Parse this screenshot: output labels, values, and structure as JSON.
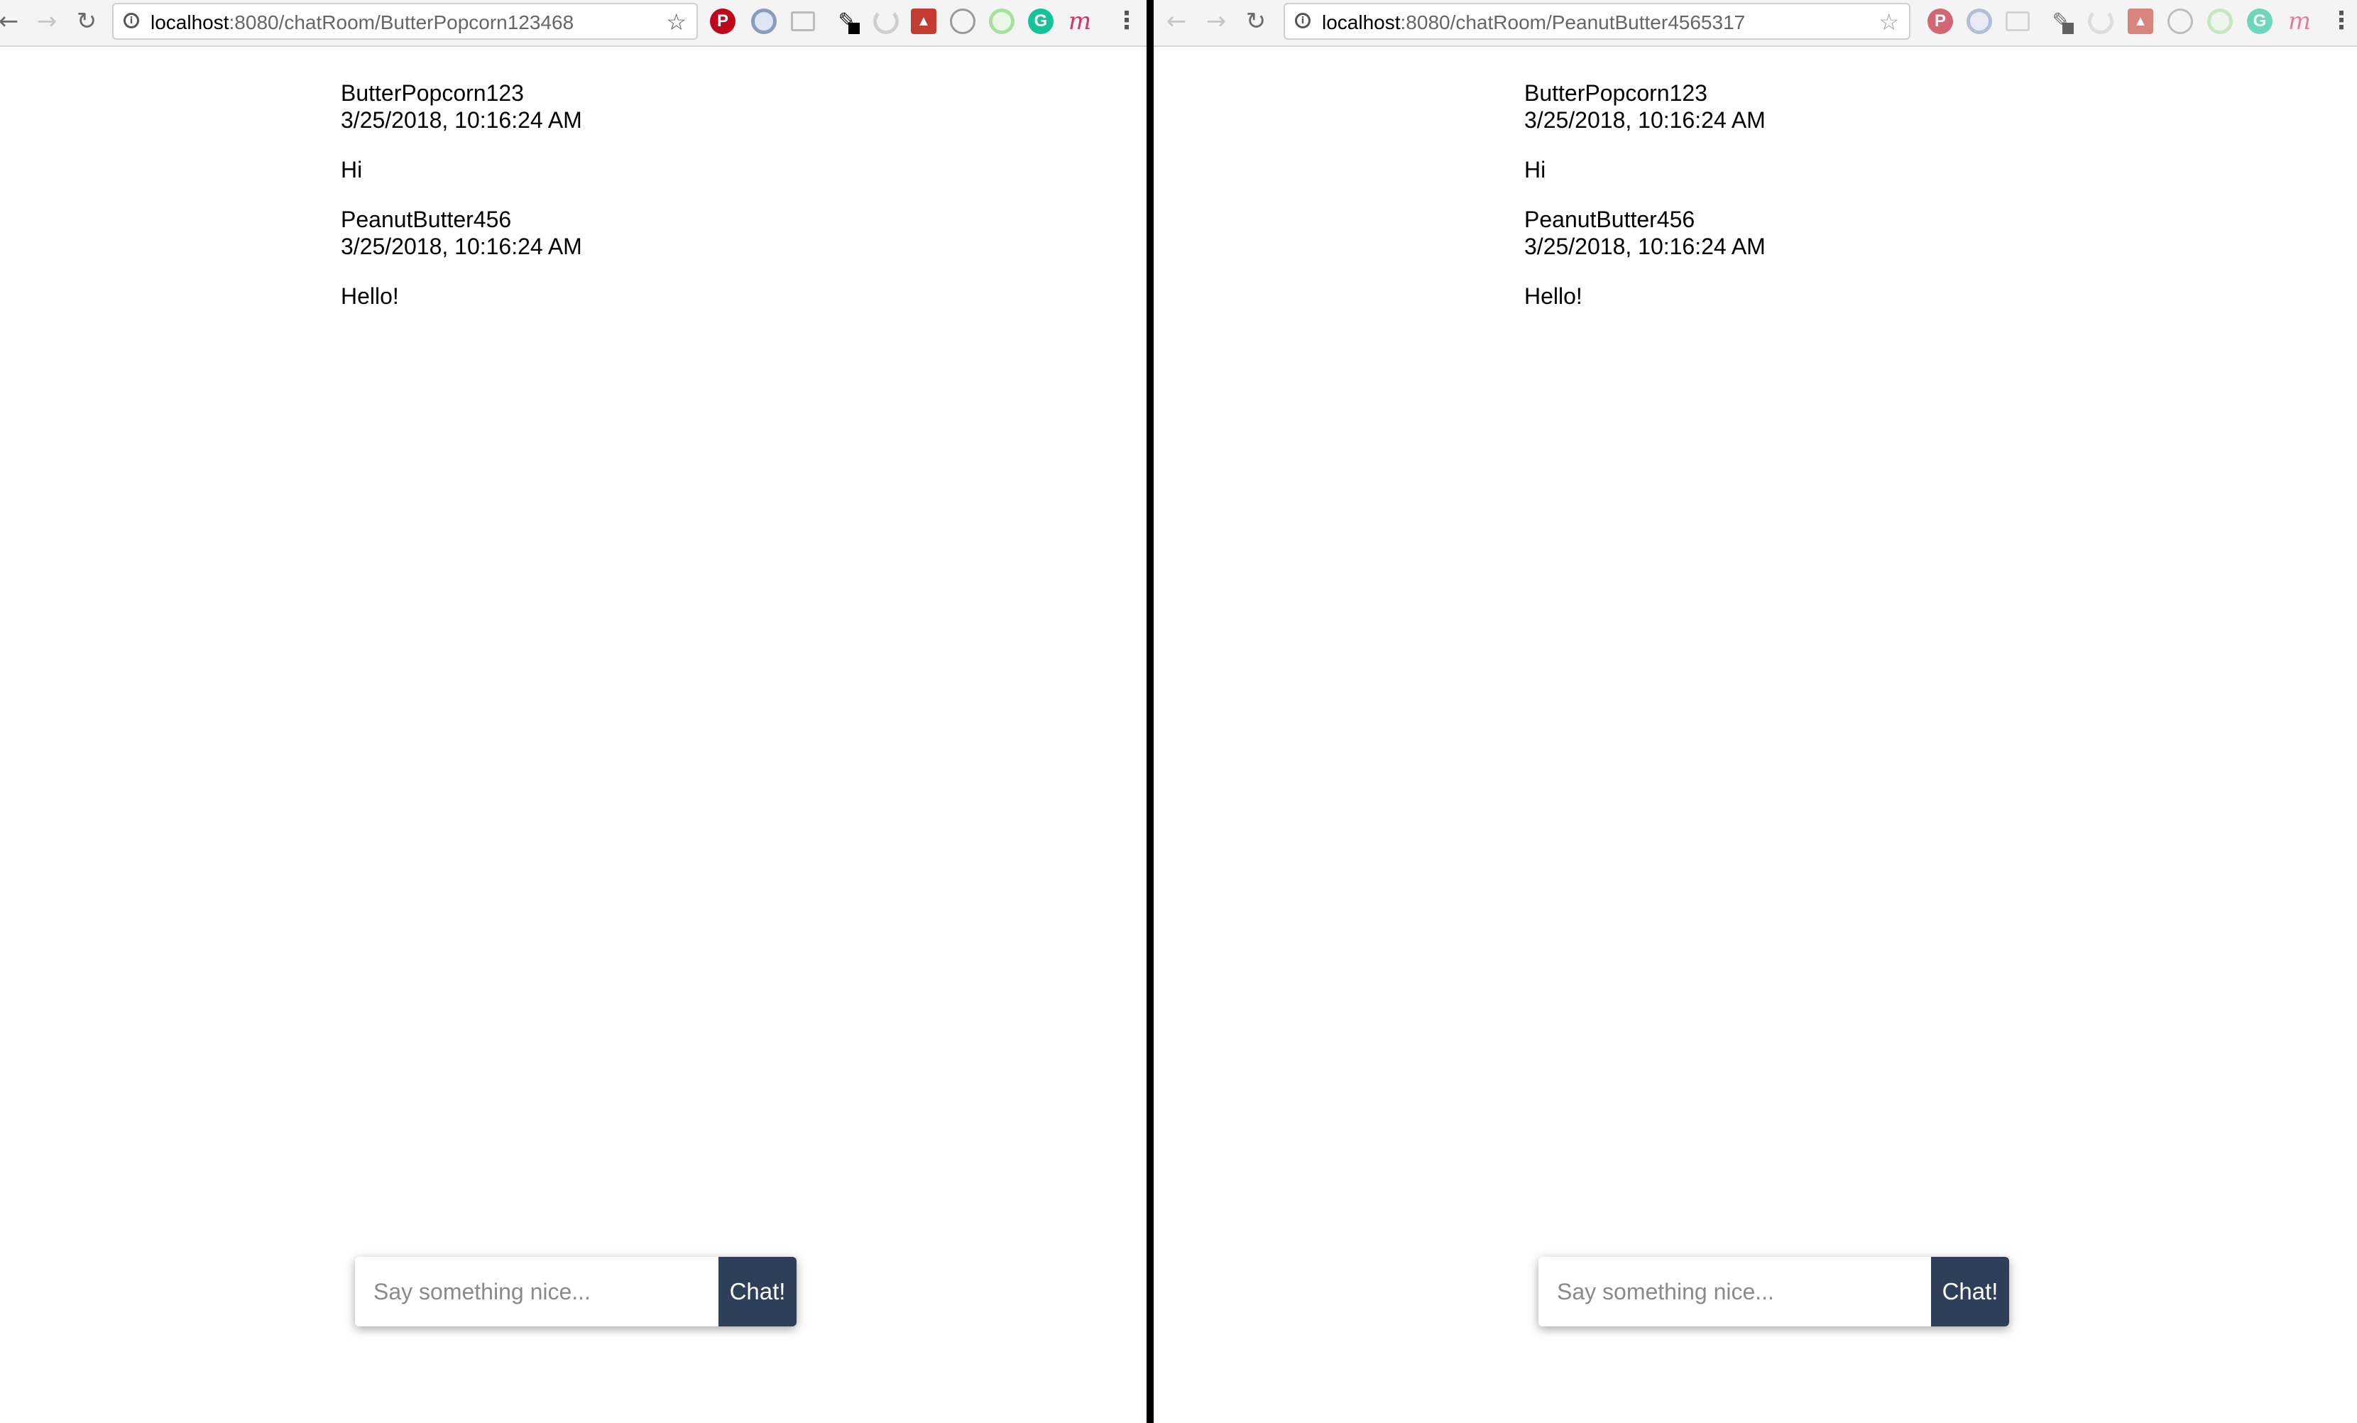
{
  "left_window": {
    "url_host": "localhost",
    "url_path": ":8080/chatRoom/ButterPopcorn123468",
    "messages": [
      {
        "user": "ButterPopcorn123",
        "time": "3/25/2018, 10:16:24 AM",
        "text": "Hi"
      },
      {
        "user": "PeanutButter456",
        "time": "3/25/2018, 10:16:24 AM",
        "text": "Hello!"
      }
    ],
    "input_placeholder": "Say something nice...",
    "button_label": "Chat!"
  },
  "right_window": {
    "url_host": "localhost",
    "url_path": ":8080/chatRoom/PeanutButter4565317",
    "messages": [
      {
        "user": "ButterPopcorn123",
        "time": "3/25/2018, 10:16:24 AM",
        "text": "Hi"
      },
      {
        "user": "PeanutButter456",
        "time": "3/25/2018, 10:16:24 AM",
        "text": "Hello!"
      }
    ],
    "input_placeholder": "Say something nice...",
    "button_label": "Chat!"
  },
  "toolbar_icons": [
    "back-icon",
    "forward-icon",
    "reload-icon",
    "info-icon",
    "star-icon",
    "pinterest-icon",
    "extension-ring-icon",
    "extension-square-icon",
    "paintbrush-icon",
    "extension-swirl-icon",
    "red-dog-icon",
    "extension-circle-icon",
    "extension-lime-icon",
    "grammarly-icon",
    "m-icon",
    "menu-icon"
  ],
  "colors": {
    "chat_button": "#2f3f59",
    "divider": "#000000",
    "toolbar": "#f4f4f4"
  }
}
